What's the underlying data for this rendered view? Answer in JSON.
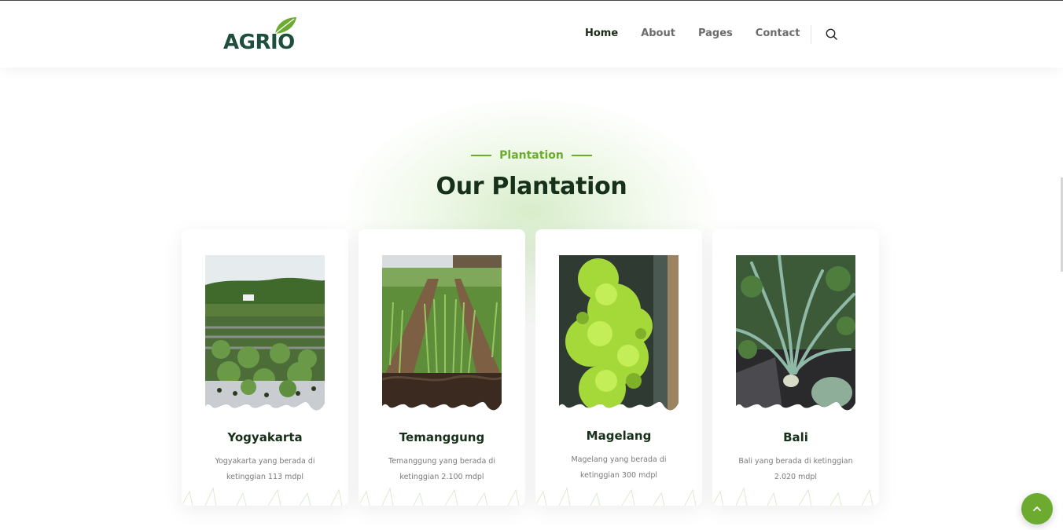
{
  "brand": {
    "logo_text": "AGRIO",
    "accent": "#6cab2f",
    "dark": "#16301a"
  },
  "nav": {
    "items": [
      {
        "label": "Home",
        "active": true
      },
      {
        "label": "About",
        "active": false
      },
      {
        "label": "Pages",
        "active": false
      },
      {
        "label": "Contact",
        "active": false
      }
    ],
    "search_icon": "search-icon"
  },
  "section": {
    "tag": "Plantation",
    "title": "Our Plantation"
  },
  "cards": [
    {
      "title": "Yogyakarta",
      "description": "Yogyakarta yang berada di ketinggian 113 mdpl"
    },
    {
      "title": "Temanggung",
      "description": "Temanggung yang berada di ketinggian 2.100 mdpl"
    },
    {
      "title": "Magelang",
      "description": "Magelang yang berada di ketinggian 300 mdpl"
    },
    {
      "title": "Bali",
      "description": "Bali yang berada di ketinggian 2.020 mdpl"
    }
  ],
  "back_to_top_icon": "arrow-up-icon"
}
